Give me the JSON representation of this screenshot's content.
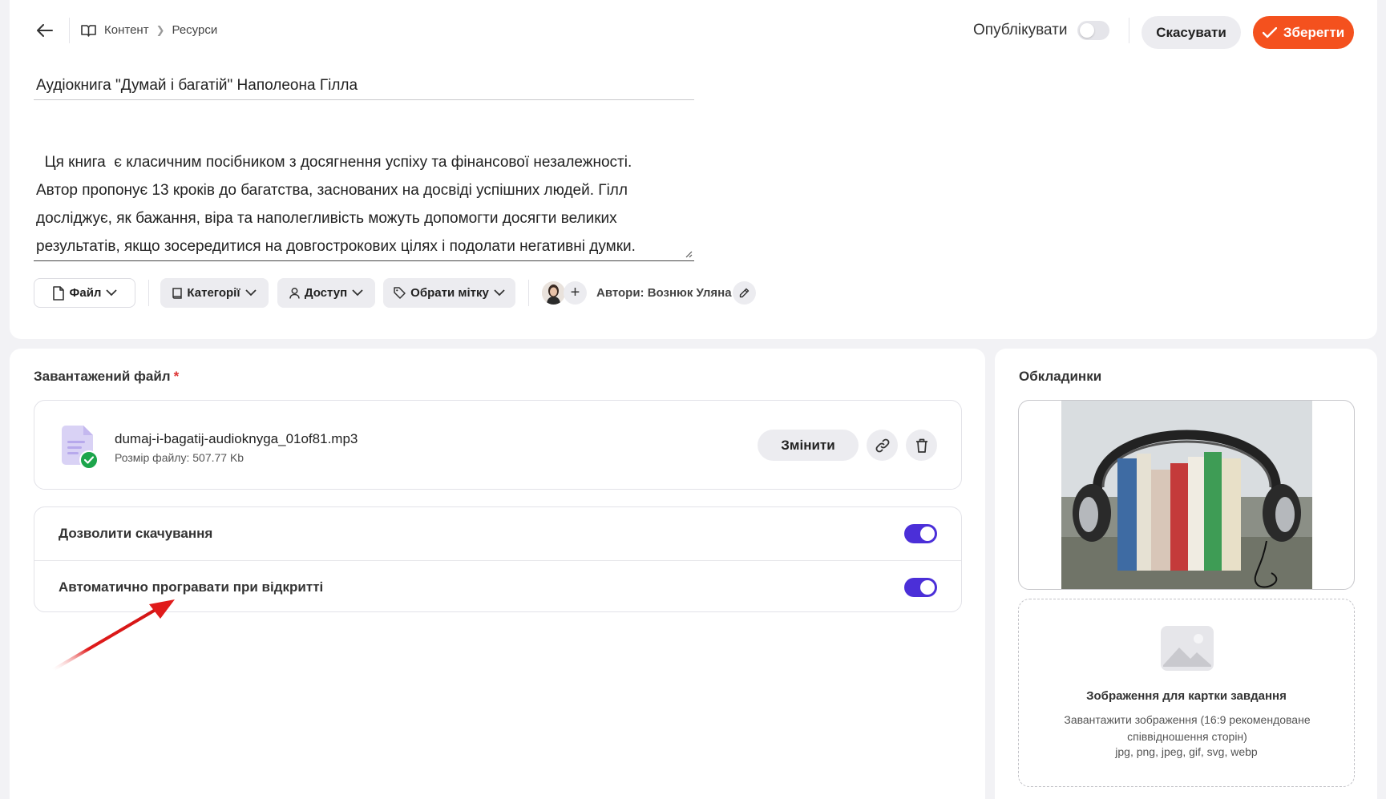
{
  "header": {
    "breadcrumbs": [
      "Контент",
      "Ресурси"
    ],
    "publish_label": "Опублікувати",
    "cancel_label": "Скасувати",
    "save_label": "Зберегти"
  },
  "editor": {
    "title": "Аудіокнига \"Думай і багатій\" Наполеона Гілла",
    "description": "Ця книга  є класичним посібником з досягнення успіху та фінансової незалежності.\nАвтор пропонує 13 кроків до багатства, заснованих на досвіді успішних людей. Гілл\nдосліджує, як бажання, віра та наполегливість можуть допомогти досягти великих\nрезультатів, якщо зосередитися на довгострокових цілях і подолати негативні думки."
  },
  "toolbar": {
    "file_label": "Файл",
    "categories_label": "Категорії",
    "access_label": "Доступ",
    "tag_label": "Обрати мітку",
    "authors_label": "Автори: Вознюк Уляна"
  },
  "uploaded_file": {
    "section_title": "Завантажений файл",
    "required_mark": "*",
    "name": "dumaj-i-bagatij-audioknyga_01of81.mp3",
    "size": "Розмір файлу: 507.77 Kb",
    "change_label": "Змінити"
  },
  "settings": {
    "allow_download": {
      "label": "Дозволити скачування",
      "enabled": true
    },
    "autoplay": {
      "label": "Автоматично програвати при відкритті",
      "enabled": true
    }
  },
  "covers": {
    "section_title": "Обкладинки",
    "upload_title": "Зображення для картки завдання",
    "upload_hint": "Завантажити зображення (16:9 рекомендоване співвідношення сторін)",
    "upload_formats": "jpg, png, jpeg, gif, svg, webp"
  },
  "colors": {
    "accent": "#f4511e",
    "toggle_on": "#4b2fd8",
    "annotation_arrow": "#e01b1b"
  }
}
